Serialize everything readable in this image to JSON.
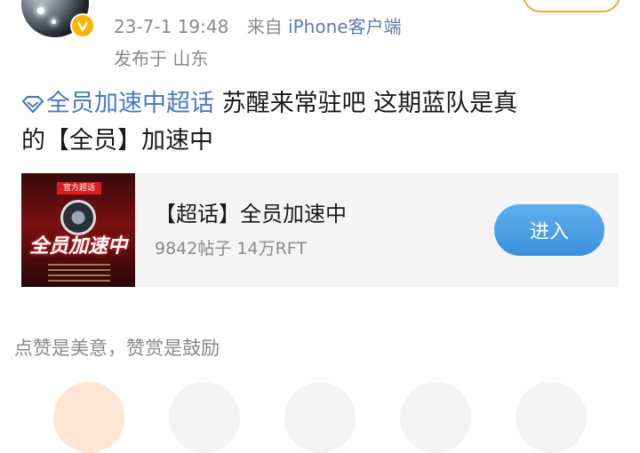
{
  "post": {
    "timestamp": "23-7-1 19:48",
    "source_prefix": "来自",
    "source": "iPhone客户端",
    "location": "发布于 山东",
    "topic": "全员加速中超话",
    "text_line1": " 苏醒来常驻吧 这期蓝队是真",
    "text_line2": "的【全员】加速中"
  },
  "card": {
    "cover_tag": "官方超话",
    "cover_logo": "全员加速中",
    "title": "【超话】全员加速中",
    "stats": "9842帖子 14万RFT",
    "enter_label": "进入"
  },
  "reward": {
    "hint": "点赞是美意，赞赏是鼓励"
  },
  "colors": {
    "link": "#4a7bc0",
    "accent_orange": "#f7a63b",
    "button_blue": "#3a90db",
    "badge_gold": "#f7b500"
  }
}
